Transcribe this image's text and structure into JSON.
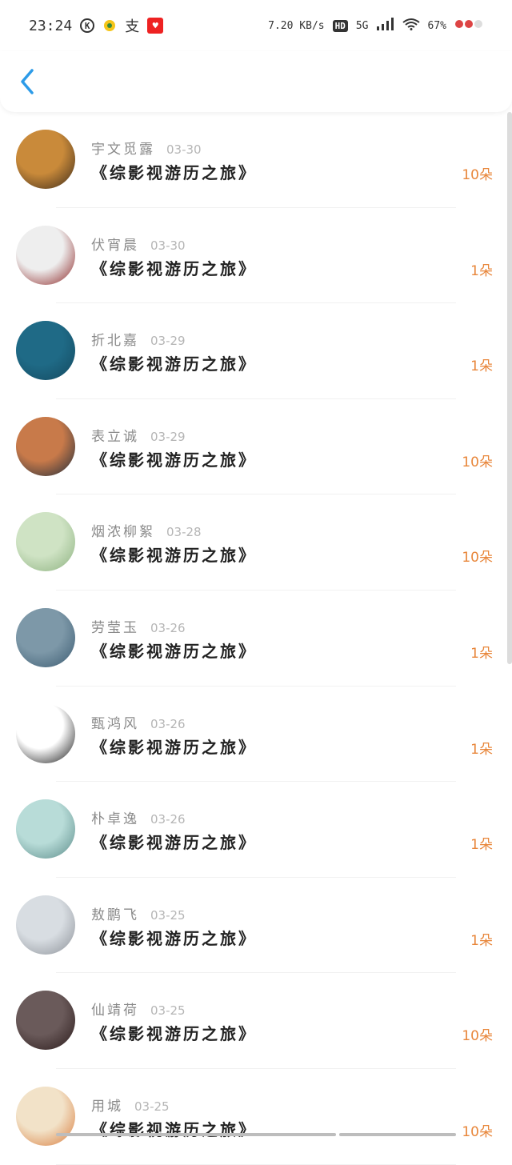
{
  "status": {
    "time": "23:24",
    "k_icon": "K",
    "app_icon_char": "支",
    "speed": "7.20 KB/s",
    "hd": "HD",
    "network": "5G",
    "battery": "67%"
  },
  "rows": [
    {
      "name": "宇文觅露",
      "date": "03-30",
      "title": "《综影视游历之旅》",
      "amount": "10朵",
      "avatar": [
        "#c98a3a",
        "#3a2a1a"
      ]
    },
    {
      "name": "伏宵晨",
      "date": "03-30",
      "title": "《综影视游历之旅》",
      "amount": "1朵",
      "avatar": [
        "#eeeeee",
        "#8a2020"
      ]
    },
    {
      "name": "折北嘉",
      "date": "03-29",
      "title": "《综影视游历之旅》",
      "amount": "1朵",
      "avatar": [
        "#1f6a86",
        "#13485e"
      ]
    },
    {
      "name": "表立诚",
      "date": "03-29",
      "title": "《综影视游历之旅》",
      "amount": "10朵",
      "avatar": [
        "#c87a4a",
        "#1a2a3a"
      ]
    },
    {
      "name": "烟浓柳絮",
      "date": "03-28",
      "title": "《综影视游历之旅》",
      "amount": "10朵",
      "avatar": [
        "#cfe3c4",
        "#8bb07e"
      ]
    },
    {
      "name": "劳莹玉",
      "date": "03-26",
      "title": "《综影视游历之旅》",
      "amount": "1朵",
      "avatar": [
        "#7d98a8",
        "#3a5a70"
      ]
    },
    {
      "name": "甄鸿风",
      "date": "03-26",
      "title": "《综影视游历之旅》",
      "amount": "1朵",
      "avatar": [
        "#ffffff",
        "#111111"
      ]
    },
    {
      "name": "朴卓逸",
      "date": "03-26",
      "title": "《综影视游历之旅》",
      "amount": "1朵",
      "avatar": [
        "#b8dcd8",
        "#5a8a88"
      ]
    },
    {
      "name": "敖鹏飞",
      "date": "03-25",
      "title": "《综影视游历之旅》",
      "amount": "1朵",
      "avatar": [
        "#d8dde2",
        "#8a8f96"
      ]
    },
    {
      "name": "仙靖荷",
      "date": "03-25",
      "title": "《综影视游历之旅》",
      "amount": "10朵",
      "avatar": [
        "#6a5a5a",
        "#2a1a1a"
      ]
    },
    {
      "name": "用城",
      "date": "03-25",
      "title": "《综影视游历之旅》",
      "amount": "10朵",
      "avatar": [
        "#f2e2c8",
        "#d87a3a"
      ]
    }
  ]
}
